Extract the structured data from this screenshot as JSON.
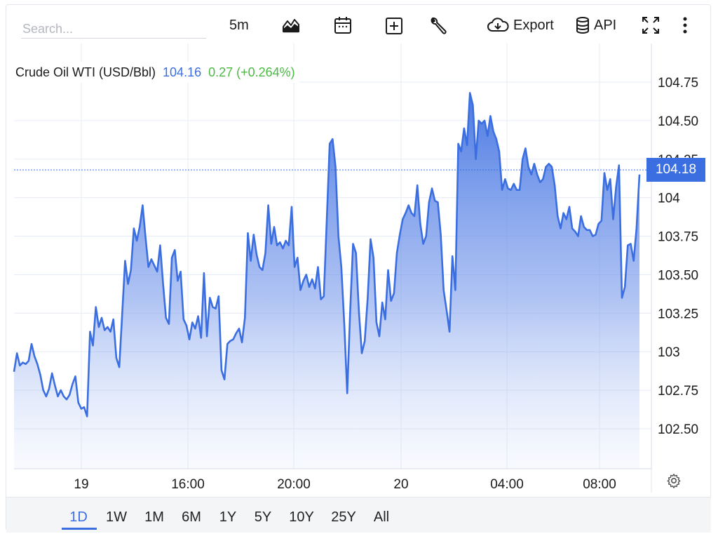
{
  "toolbar": {
    "search_placeholder": "Search...",
    "interval_label": "5m",
    "export_label": "Export",
    "api_label": "API"
  },
  "legend": {
    "name": "Crude Oil WTI (USD/Bbl)",
    "price": "104.16",
    "change": "0.27 (+0.264%)"
  },
  "last_price_label": "104.18",
  "ranges": [
    "1D",
    "1W",
    "1M",
    "6M",
    "1Y",
    "5Y",
    "10Y",
    "25Y",
    "All"
  ],
  "active_range": "1D",
  "colors": {
    "line": "#3b6ee0",
    "positive": "#4cb944",
    "grid": "#e6ecf5"
  },
  "chart_data": {
    "type": "area",
    "title": "Crude Oil WTI (USD/Bbl)",
    "x_ticks": [
      "19",
      "16:00",
      "20:00",
      "20",
      "04:00",
      "08:00"
    ],
    "y_ticks": [
      "102.50",
      "102.75",
      "103",
      "103.25",
      "103.50",
      "103.75",
      "104",
      "104.25",
      "104.50",
      "104.75"
    ],
    "ylim": [
      102.25,
      104.95
    ],
    "last_value": 104.18,
    "series": [
      {
        "values": [
          102.87,
          102.99,
          102.91,
          102.93,
          102.92,
          102.94,
          103.05,
          102.97,
          102.92,
          102.85,
          102.75,
          102.71,
          102.76,
          102.86,
          102.78,
          102.71,
          102.75,
          102.71,
          102.69,
          102.72,
          102.79,
          102.84,
          102.67,
          102.63,
          102.64,
          102.58,
          103.13,
          103.04,
          103.29,
          103.16,
          103.22,
          103.14,
          103.16,
          103.13,
          103.21,
          102.96,
          102.9,
          103.24,
          103.59,
          103.44,
          103.53,
          103.8,
          103.72,
          103.81,
          103.95,
          103.74,
          103.55,
          103.6,
          103.56,
          103.52,
          103.69,
          103.44,
          103.22,
          103.18,
          103.61,
          103.66,
          103.46,
          103.52,
          103.21,
          103.17,
          103.08,
          103.19,
          103.15,
          103.23,
          103.09,
          103.51,
          103.1,
          103.35,
          103.29,
          103.28,
          103.36,
          102.88,
          102.82,
          103.05,
          103.07,
          103.08,
          103.12,
          103.15,
          103.06,
          103.22,
          103.77,
          103.59,
          103.76,
          103.63,
          103.55,
          103.53,
          103.64,
          103.95,
          103.7,
          103.81,
          103.69,
          103.71,
          103.67,
          103.72,
          103.69,
          103.94,
          103.55,
          103.61,
          103.4,
          103.46,
          103.5,
          103.42,
          103.47,
          103.41,
          103.55,
          103.34,
          103.36,
          103.85,
          104.35,
          104.38,
          104.2,
          103.75,
          103.55,
          103.18,
          102.73,
          103.25,
          103.7,
          103.64,
          103.26,
          102.99,
          103.07,
          103.35,
          103.73,
          103.61,
          103.19,
          103.1,
          103.32,
          103.21,
          103.53,
          103.33,
          103.38,
          103.64,
          103.76,
          103.86,
          103.9,
          103.95,
          103.9,
          103.88,
          104.08,
          103.83,
          103.7,
          103.75,
          103.97,
          104.06,
          103.98,
          103.97,
          103.76,
          103.4,
          103.27,
          103.13,
          103.62,
          103.4,
          104.35,
          104.3,
          104.45,
          104.34,
          104.68,
          104.6,
          104.25,
          104.5,
          104.48,
          104.5,
          104.4,
          104.53,
          104.43,
          104.38,
          104.3,
          104.05,
          104.12,
          104.06,
          104.05,
          104.09,
          104.05,
          104.05,
          104.25,
          104.32,
          104.2,
          104.15,
          104.22,
          104.15,
          104.1,
          104.12,
          104.2,
          104.22,
          104.2,
          104.08,
          103.88,
          103.8,
          103.9,
          103.86,
          103.94,
          103.8,
          103.78,
          103.75,
          103.88,
          103.81,
          103.79,
          103.79,
          103.75,
          103.76,
          103.83,
          103.85,
          104.16,
          104.05,
          104.12,
          103.86,
          104.07,
          104.21,
          103.35,
          103.42,
          103.69,
          103.7,
          103.59,
          103.8,
          104.15
        ]
      }
    ]
  }
}
